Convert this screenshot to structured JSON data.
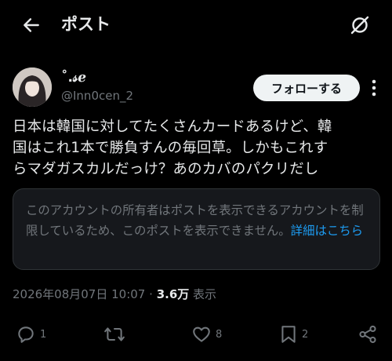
{
  "header": {
    "title": "ポスト",
    "back_icon": "arrow-left-icon",
    "grok_icon": "grok-icon"
  },
  "author": {
    "display_name": "˚.𝓈ℯ",
    "handle": "@Inn0cen_2",
    "follow_label": "フォローする",
    "more_icon": "more-vertical-icon"
  },
  "post": {
    "lines": [
      "日本は韓国に対してたくさんカードあるけど、韓",
      "国はこれ1本で勝負すんの毎回草。しかもこれす",
      "らマダガスカルだっけ？あのカバのパクリだし"
    ]
  },
  "notice": {
    "text": "このアカウントの所有者はポストを表示できるアカウントを制限しているため、このポストを表示できません。",
    "link": "詳細はこちら"
  },
  "meta": {
    "timestamp": "2026年08月07日 10:07",
    "separator": "·",
    "views_count": "3.6万",
    "views_label": "表示"
  },
  "actions": {
    "reply_count": "1",
    "repost_count": "",
    "like_count": "8",
    "bookmark_count": "2"
  },
  "colors": {
    "background": "#000000",
    "text": "#e7e9ea",
    "muted": "#71767b",
    "link": "#1d9bf0",
    "notice_bg": "#16181c",
    "border": "#2f3336"
  }
}
